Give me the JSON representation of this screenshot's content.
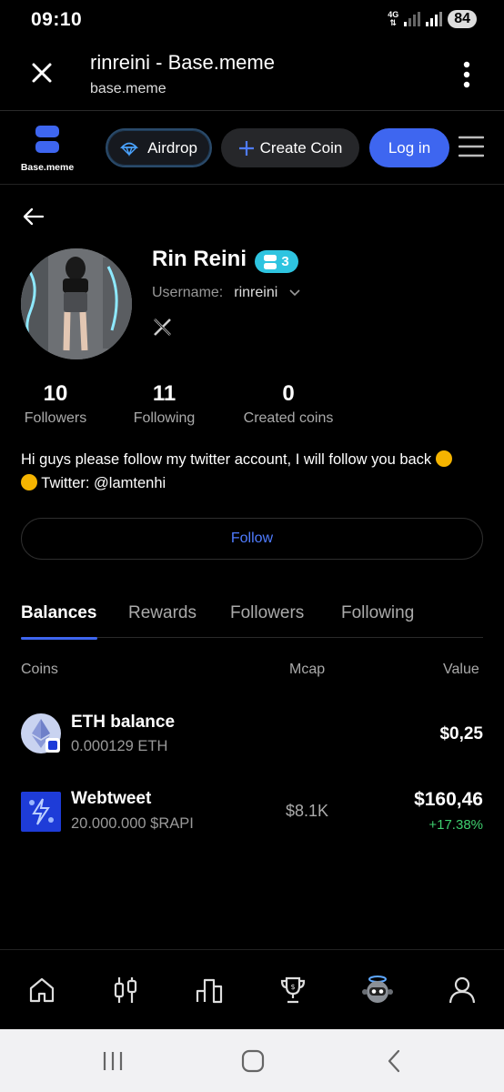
{
  "status": {
    "time": "09:10",
    "network": "4G",
    "battery": "84"
  },
  "browser": {
    "title": "rinreini - Base.meme",
    "url": "base.meme"
  },
  "header": {
    "logo_text": "Base.meme",
    "airdrop_label": "Airdrop",
    "create_label": "Create Coin",
    "login_label": "Log in"
  },
  "profile": {
    "name": "Rin Reini",
    "level": "3",
    "username_label": "Username:",
    "username": "rinreini",
    "stats": [
      {
        "value": "10",
        "label": "Followers"
      },
      {
        "value": "11",
        "label": "Following"
      },
      {
        "value": "0",
        "label": "Created coins"
      }
    ],
    "bio_line1": "Hi guys please follow my twitter account, I will follow you back",
    "bio_line2": "Twitter: @lamtenhi",
    "follow_label": "Follow"
  },
  "tabs": [
    "Balances",
    "Rewards",
    "Followers",
    "Following"
  ],
  "table": {
    "headers": {
      "coins": "Coins",
      "mcap": "Mcap",
      "value": "Value"
    },
    "rows": [
      {
        "name": "ETH balance",
        "amount": "0.000129 ETH",
        "mcap": "",
        "value": "$0,25",
        "change": ""
      },
      {
        "name": "Webtweet",
        "amount": "20.000.000 $RAPI",
        "mcap": "$8.1K",
        "value": "$160,46",
        "change": "+17.38%"
      }
    ]
  },
  "colors": {
    "accent": "#3e66f0",
    "positive": "#3ecf6e",
    "badge": "#2ec4e0"
  }
}
